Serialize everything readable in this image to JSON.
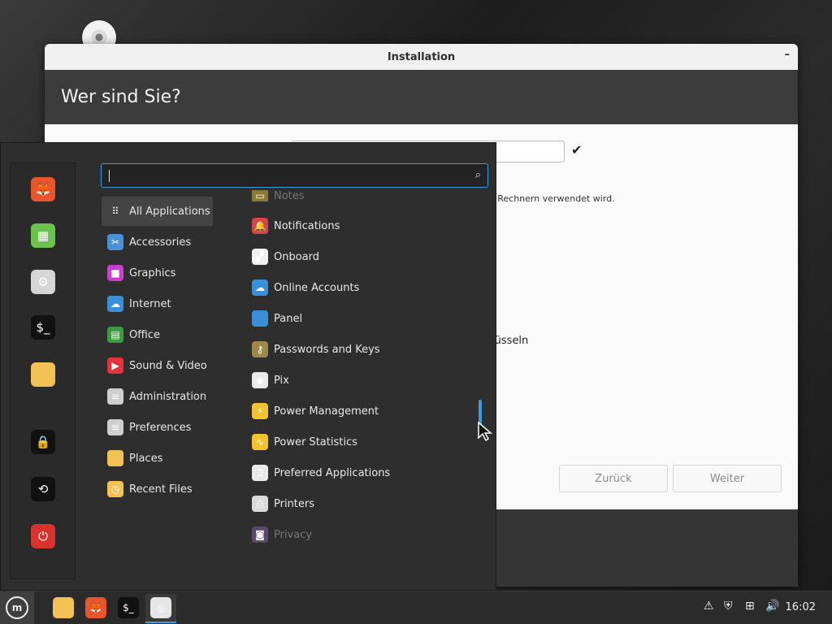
{
  "window": {
    "title": "Installation",
    "minimize_symbol": "–",
    "heading": "Wer sind Sie?",
    "hint_text": "en Rechnern verwendet wird.",
    "encrypt_text": "lüsseln",
    "back_label": "Zurück",
    "next_label": "Weiter",
    "check_symbol": "✔"
  },
  "menu": {
    "search_placeholder": "",
    "favorites": [
      {
        "name": "firefox-icon",
        "glyph": "🦊",
        "color": "#e8552c"
      },
      {
        "name": "software-manager-icon",
        "glyph": "▦",
        "color": "#6cc24a"
      },
      {
        "name": "settings-icon",
        "glyph": "⚙",
        "color": "#d6d6d6"
      },
      {
        "name": "terminal-icon",
        "glyph": "$_",
        "color": "#111111"
      },
      {
        "name": "files-icon",
        "glyph": "",
        "color": "#f2c255"
      },
      {
        "name": "lock-icon",
        "glyph": "🔒",
        "color": "#111111"
      },
      {
        "name": "logout-icon",
        "glyph": "⟲",
        "color": "#111111"
      },
      {
        "name": "power-icon",
        "glyph": "⏻",
        "color": "#d9332e"
      }
    ],
    "categories": [
      {
        "label": "All Applications",
        "icon": "grid-icon",
        "color": "transparent",
        "glyph": "⠿"
      },
      {
        "label": "Accessories",
        "icon": "scissors-icon",
        "color": "#4a90d9",
        "glyph": "✂"
      },
      {
        "label": "Graphics",
        "icon": "graphics-icon",
        "color": "#c93fd0",
        "glyph": "■"
      },
      {
        "label": "Internet",
        "icon": "cloud-icon",
        "color": "#3b8fd9",
        "glyph": "☁"
      },
      {
        "label": "Office",
        "icon": "office-icon",
        "color": "#3e9a3e",
        "glyph": "▤"
      },
      {
        "label": "Sound & Video",
        "icon": "play-icon",
        "color": "#e2343c",
        "glyph": "▶"
      },
      {
        "label": "Administration",
        "icon": "admin-icon",
        "color": "#cfcfcf",
        "glyph": "≡"
      },
      {
        "label": "Preferences",
        "icon": "preferences-icon",
        "color": "#cfcfcf",
        "glyph": "≡"
      },
      {
        "label": "Places",
        "icon": "folder-icon",
        "color": "#f2c255",
        "glyph": ""
      },
      {
        "label": "Recent Files",
        "icon": "recent-folder-icon",
        "color": "#f2c255",
        "glyph": "◷"
      }
    ],
    "apps": [
      {
        "label": "Notes",
        "icon": "notes-icon",
        "color": "#8a7a3a",
        "glyph": "▭",
        "faded": true
      },
      {
        "label": "Notifications",
        "icon": "bell-icon",
        "color": "#d3454f",
        "glyph": "🔔",
        "faded": false
      },
      {
        "label": "Onboard",
        "icon": "keyboard-icon",
        "color": "#f1f1f1",
        "glyph": "▞",
        "faded": false
      },
      {
        "label": "Online Accounts",
        "icon": "cloud-icon",
        "color": "#3b8fd9",
        "glyph": "☁",
        "faded": false
      },
      {
        "label": "Panel",
        "icon": "panel-icon",
        "color": "#3b8fd9",
        "glyph": "",
        "faded": false
      },
      {
        "label": "Passwords and Keys",
        "icon": "key-icon",
        "color": "#9d8a4a",
        "glyph": "⚷",
        "faded": false
      },
      {
        "label": "Pix",
        "icon": "pix-icon",
        "color": "#e9e9e9",
        "glyph": "◉",
        "faded": false
      },
      {
        "label": "Power Management",
        "icon": "power-management-icon",
        "color": "#f2c233",
        "glyph": "⚡",
        "faded": false
      },
      {
        "label": "Power Statistics",
        "icon": "power-statistics-icon",
        "color": "#f2c233",
        "glyph": "∿",
        "faded": false
      },
      {
        "label": "Preferred Applications",
        "icon": "preferred-apps-icon",
        "color": "#e9e9e9",
        "glyph": "♫",
        "faded": false
      },
      {
        "label": "Printers",
        "icon": "printer-icon",
        "color": "#d9d9d9",
        "glyph": "⎙",
        "faded": false
      },
      {
        "label": "Privacy",
        "icon": "privacy-icon",
        "color": "#5a4a6a",
        "glyph": "◙",
        "faded": true
      }
    ]
  },
  "panel": {
    "clock": "16:02",
    "tasks": [
      {
        "name": "files-task-icon",
        "glyph": "",
        "color": "#f2c255"
      },
      {
        "name": "firefox-task-icon",
        "glyph": "🦊",
        "color": "#e8552c"
      },
      {
        "name": "terminal-task-icon",
        "glyph": "$_",
        "color": "#111111"
      },
      {
        "name": "installer-task-icon",
        "glyph": "◎",
        "color": "#e6e6e6"
      }
    ],
    "tray": [
      {
        "name": "update-manager-icon",
        "glyph": "⚠"
      },
      {
        "name": "shield-icon",
        "glyph": "⛨"
      },
      {
        "name": "network-icon",
        "glyph": "⊞"
      },
      {
        "name": "volume-icon",
        "glyph": "🔊"
      }
    ]
  }
}
